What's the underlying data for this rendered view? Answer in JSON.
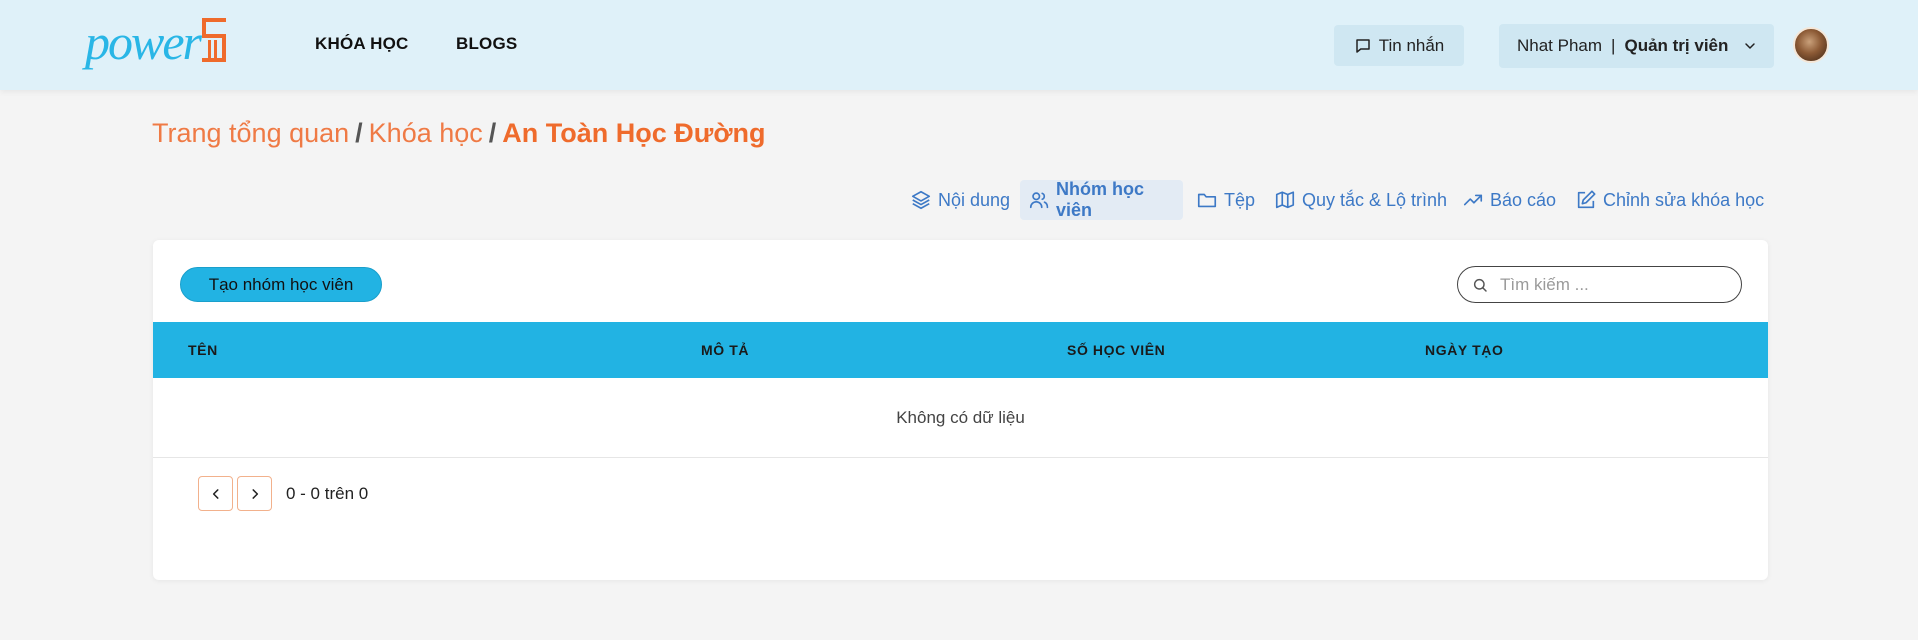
{
  "header": {
    "logo_text": "power",
    "logo_number": "5",
    "nav": {
      "courses": "KHÓA HỌC",
      "blogs": "BLOGS"
    },
    "messages_label": "Tin nhắn",
    "user": {
      "name": "Nhat Pham",
      "separator": "|",
      "role": "Quản trị viên"
    }
  },
  "breadcrumb": {
    "items": [
      "Trang tổng quan",
      "Khóa học"
    ],
    "separator": "/",
    "current": "An Toàn Học Đường"
  },
  "tabs": [
    {
      "label": "Nội dung",
      "icon": "layers-icon",
      "active": false
    },
    {
      "label": "Nhóm học viên",
      "icon": "users-icon",
      "active": true
    },
    {
      "label": "Tệp",
      "icon": "folder-icon",
      "active": false
    },
    {
      "label": "Quy tắc & Lộ trình",
      "icon": "map-icon",
      "active": false
    },
    {
      "label": "Báo cáo",
      "icon": "trending-up-icon",
      "active": false
    },
    {
      "label": "Chỉnh sửa khóa học",
      "icon": "edit-icon",
      "active": false
    }
  ],
  "groups": {
    "create_button": "Tạo nhóm học viên",
    "search_placeholder": "Tìm kiếm ...",
    "columns": [
      "TÊN",
      "MÔ TẢ",
      "SỐ HỌC VIÊN",
      "NGÀY TẠO"
    ],
    "empty_message": "Không có dữ liệu",
    "pagination": {
      "range_text": "0 - 0 trên 0"
    }
  },
  "colors": {
    "brand_blue": "#22b3e3",
    "brand_orange": "#ef6b2c",
    "header_bg": "#dff1f9",
    "tab_blue": "#3d79c6"
  }
}
